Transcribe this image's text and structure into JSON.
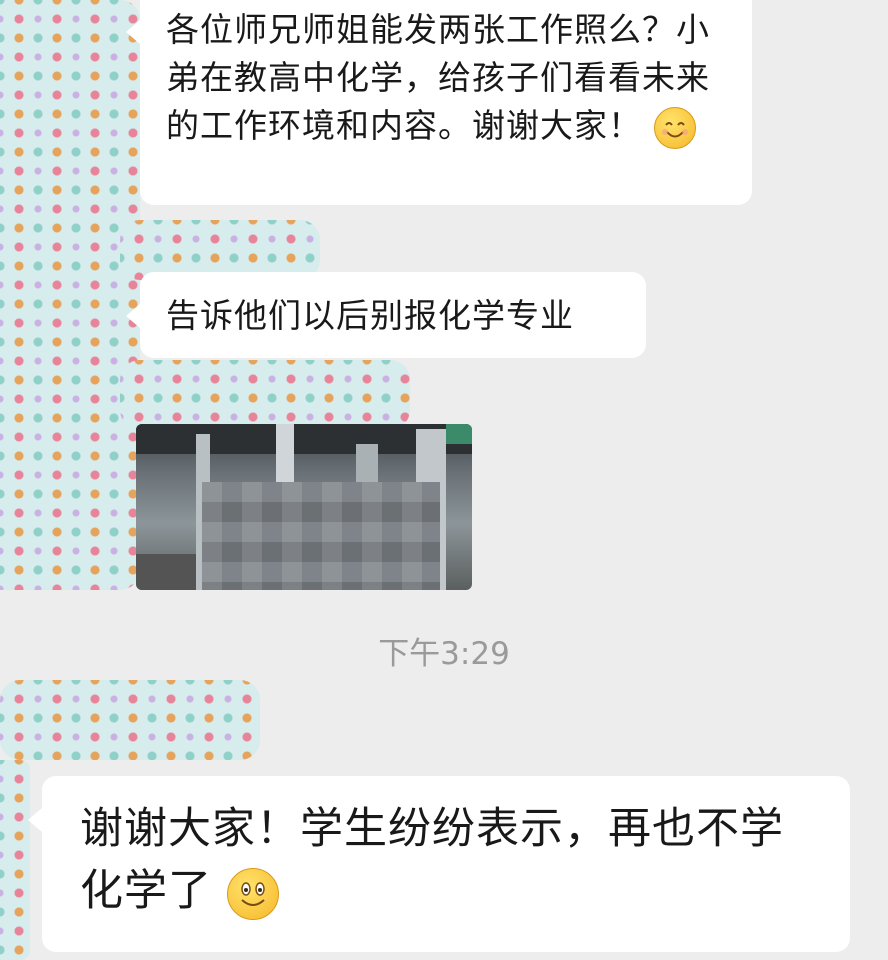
{
  "messages": [
    {
      "text": "各位师兄师姐能发两张工作照么？小弟在教高中化学，给孩子们看看未来的工作环境和内容。谢谢大家！",
      "emoji": "smiling-face-icon"
    },
    {
      "text": "告诉他们以后别报化学专业"
    },
    {
      "image": "blurred-factory-photo"
    },
    {
      "text": "谢谢大家！学生纷纷表示，再也不学化学了",
      "emoji": "grinning-face-icon"
    }
  ],
  "timestamp": "下午3:29"
}
